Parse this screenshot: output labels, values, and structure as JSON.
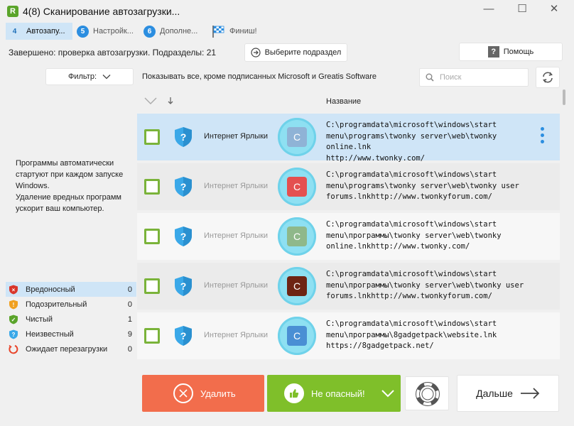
{
  "window": {
    "title": "4(8) Сканирование автозагрузки...",
    "logo": "R",
    "controls": [
      "—",
      "☐",
      "✕"
    ]
  },
  "steps": [
    {
      "num": "4",
      "label": "Автозапу...",
      "active": true
    },
    {
      "num": "5",
      "label": "Настройк...",
      "active": false
    },
    {
      "num": "6",
      "label": "Дополне...",
      "active": false
    },
    {
      "num": "",
      "label": "Финиш!",
      "active": false,
      "icon": "checkered-flag-icon"
    }
  ],
  "status": "Завершено: проверка автозагрузки. Подразделы: 21",
  "select_section_label": "Выберите подраздел",
  "help_label": "Помощь",
  "filter": {
    "label": "Фильтр:",
    "description": "Показывать все, кроме подписанных Microsoft и Greatis Software"
  },
  "search": {
    "placeholder": "Поиск",
    "value": ""
  },
  "list": {
    "column_name": "Название",
    "rows": [
      {
        "category": "Интернет Ярлыки",
        "app_letter": "C",
        "app_color": "#8fb3d6",
        "path_lines": [
          "C:\\programdata\\microsoft\\windows\\start",
          "menu\\programs\\twonky server\\web\\twonky online.lnk",
          "http://www.twonky.com/"
        ],
        "selected": true
      },
      {
        "category": "Интернет Ярлыки",
        "app_letter": "C",
        "app_color": "#e45050",
        "path_lines": [
          "C:\\programdata\\microsoft\\windows\\start",
          "menu\\programs\\twonky server\\web\\twonky user",
          "forums.lnkhttp://www.twonkyforum.com/"
        ],
        "selected": false
      },
      {
        "category": "Интернет Ярлыки",
        "app_letter": "C",
        "app_color": "#8fb88a",
        "path_lines": [
          "C:\\programdata\\microsoft\\windows\\start",
          "menu\\программы\\twonky server\\web\\twonky",
          "online.lnkhttp://www.twonky.com/"
        ],
        "selected": false
      },
      {
        "category": "Интернет Ярлыки",
        "app_letter": "C",
        "app_color": "#6e2414",
        "path_lines": [
          "C:\\programdata\\microsoft\\windows\\start",
          "menu\\программы\\twonky server\\web\\twonky user",
          "forums.lnkhttp://www.twonkyforum.com/"
        ],
        "selected": false
      },
      {
        "category": "Интернет Ярлыки",
        "app_letter": "C",
        "app_color": "#4a8fd4",
        "path_lines": [
          "C:\\programdata\\microsoft\\windows\\start",
          "menu\\программы\\8gadgetpack\\website.lnk",
          "https://8gadgetpack.net/"
        ],
        "selected": false
      }
    ]
  },
  "info_text": [
    "Программы автоматически",
    "стартуют при каждом запуске",
    "Windows.",
    "Удаление вредных программ",
    "ускорит ваш компьютер."
  ],
  "legend": [
    {
      "label": "Вредоносный",
      "count": "0",
      "icon": "malicious-shield-icon",
      "color": "#d9362b",
      "selected": true
    },
    {
      "label": "Подозрительный",
      "count": "0",
      "icon": "suspicious-shield-icon",
      "color": "#f0a020",
      "selected": false
    },
    {
      "label": "Чистый",
      "count": "1",
      "icon": "clean-shield-icon",
      "color": "#5aa42a",
      "selected": false
    },
    {
      "label": "Неизвестный",
      "count": "9",
      "icon": "unknown-shield-icon",
      "color": "#3aa8e8",
      "selected": false
    },
    {
      "label": "Ожидает перезагрузки",
      "count": "0",
      "icon": "reboot-icon",
      "color": "#e8442a",
      "selected": false
    }
  ],
  "actions": {
    "delete_label": "Удалить",
    "safe_label": "Не опасный!",
    "next_label": "Дальше"
  },
  "colors": {
    "accent_blue": "#2c8ee0",
    "delete_orange": "#f26d4c",
    "safe_green": "#7fbf2a",
    "selection": "#cfe5f7"
  }
}
